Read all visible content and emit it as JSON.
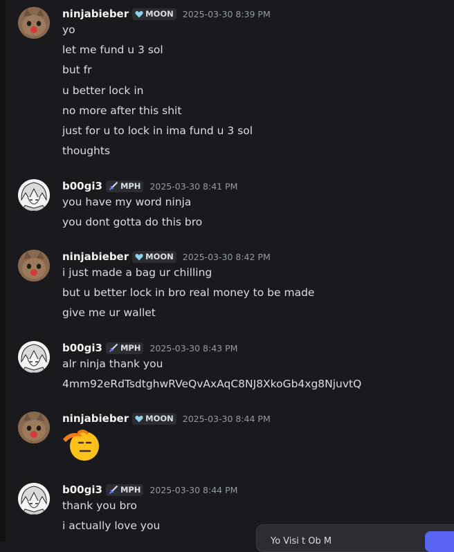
{
  "messages": [
    {
      "author": "ninjabieber",
      "avatar": "cat-avatar",
      "badge": {
        "icon": "heart-icon",
        "label": "MOON"
      },
      "timestamp": "2025-03-30 8:39 PM",
      "lines": [
        "yo",
        "let me fund u 3 sol",
        "but fr",
        "u better lock in",
        "no more after this shit",
        "just for u to lock in ima fund u 3 sol",
        "thoughts"
      ]
    },
    {
      "author": "b00gi3",
      "avatar": "anime-avatar",
      "badge": {
        "icon": "sword-icon",
        "label": "MPH"
      },
      "timestamp": "2025-03-30 8:41 PM",
      "lines": [
        "you have my word ninja",
        "you dont gotta do this bro"
      ]
    },
    {
      "author": "ninjabieber",
      "avatar": "cat-avatar",
      "badge": {
        "icon": "heart-icon",
        "label": "MOON"
      },
      "timestamp": "2025-03-30 8:42 PM",
      "lines": [
        "i just made a bag ur chilling",
        "but  u better lock in bro real money to be made",
        "give me ur wallet"
      ]
    },
    {
      "author": "b00gi3",
      "avatar": "anime-avatar",
      "badge": {
        "icon": "sword-icon",
        "label": "MPH"
      },
      "timestamp": "2025-03-30 8:43 PM",
      "lines": [
        "alr ninja thank you",
        "4mm92eRdTsdtghwRVeQvAxAqC8NJ8XkoGb4xg8NjuvtQ"
      ]
    },
    {
      "author": "ninjabieber",
      "avatar": "cat-avatar",
      "badge": {
        "icon": "heart-icon",
        "label": "MOON"
      },
      "timestamp": "2025-03-30 8:44 PM",
      "emoji": "saluting-face-emoji"
    },
    {
      "author": "b00gi3",
      "avatar": "anime-avatar",
      "badge": {
        "icon": "sword-icon",
        "label": "MPH"
      },
      "timestamp": "2025-03-30 8:44 PM",
      "lines": [
        "thank you bro",
        "i actually love you"
      ]
    }
  ],
  "input_bar": {
    "partial_text": "Yo   Visi   t Ob     M"
  },
  "colors": {
    "background": "#1a1a1e",
    "badge_bg": "#2b2d31",
    "timestamp": "#949ba4",
    "accent": "#5865f2"
  }
}
